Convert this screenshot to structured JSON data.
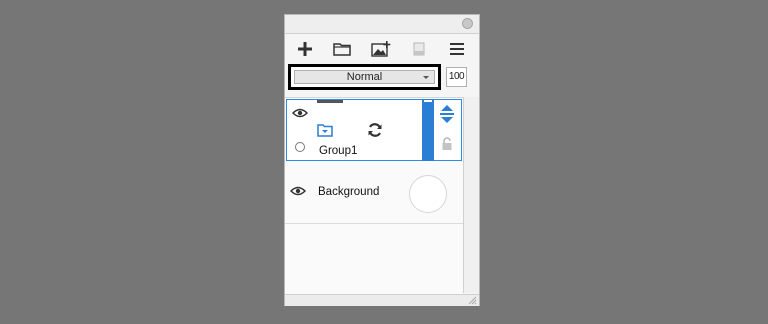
{
  "layer_panel": {
    "toolbar": {
      "new_layer_icon": "plus-icon",
      "new_folder_icon": "folder-icon",
      "new_image_layer_icon": "image-add-icon",
      "mask_icon": "mask-icon",
      "menu_icon": "hamburger-menu-icon"
    },
    "blend_mode": {
      "selected": "Normal"
    },
    "opacity": {
      "value": "100"
    },
    "layers": [
      {
        "name": "Group1",
        "type": "group",
        "visible": true,
        "selected": true
      },
      {
        "name": "Background",
        "type": "raster",
        "visible": true,
        "selected": false
      }
    ]
  },
  "colors": {
    "accent": "#2a7fd4",
    "background": "#767676",
    "panel": "#f5f5f5"
  }
}
